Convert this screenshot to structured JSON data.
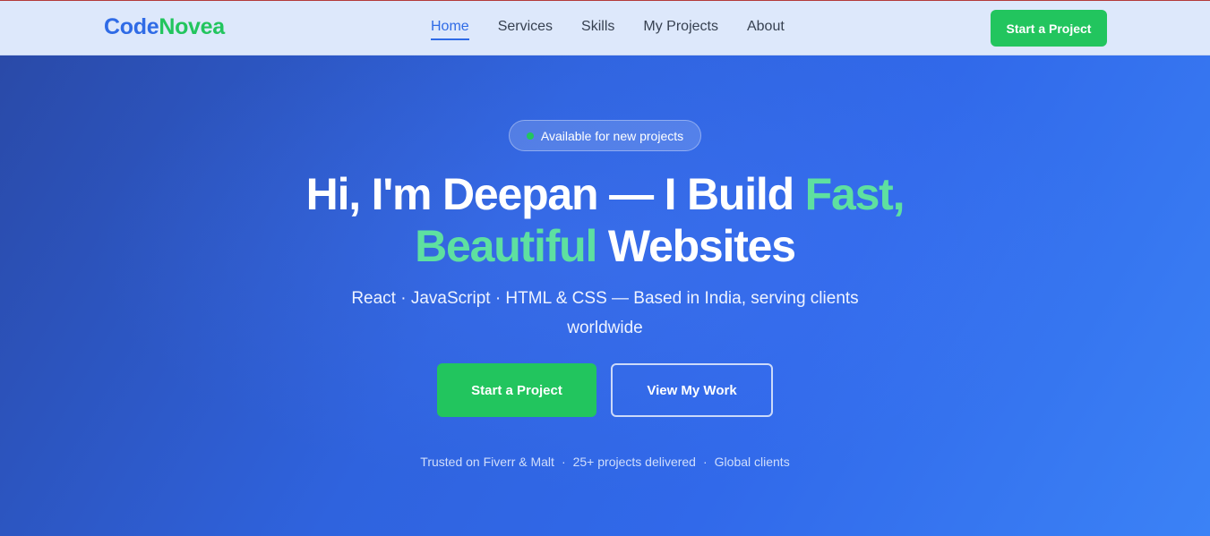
{
  "brand": {
    "part1": "Code",
    "part2": "Novea"
  },
  "nav": {
    "links": [
      "Home",
      "Services",
      "Skills",
      "My Projects",
      "About"
    ],
    "active": "Home",
    "cta_label": "Start a Project"
  },
  "hero": {
    "badge_label": "Available for new projects",
    "headline": {
      "line1_plain": "Hi, I'm Deepan — I Build ",
      "line1_accent": "Fast,",
      "line2_accent": "Beautiful",
      "line2_plain": " Websites"
    },
    "subtitle": "React · JavaScript · HTML & CSS — Based in India, serving clients worldwide",
    "primary_cta": "Start a Project",
    "secondary_cta": "View My Work",
    "trust_items": [
      "Trusted on Fiverr & Malt",
      "25+ projects delivered",
      "Global clients"
    ],
    "trust_separator": "·"
  },
  "colors": {
    "brand_blue": "#2f6be6",
    "brand_green": "#22c55e",
    "accent_text": "#5ee0a0",
    "nav_bg": "#dde8fb"
  }
}
